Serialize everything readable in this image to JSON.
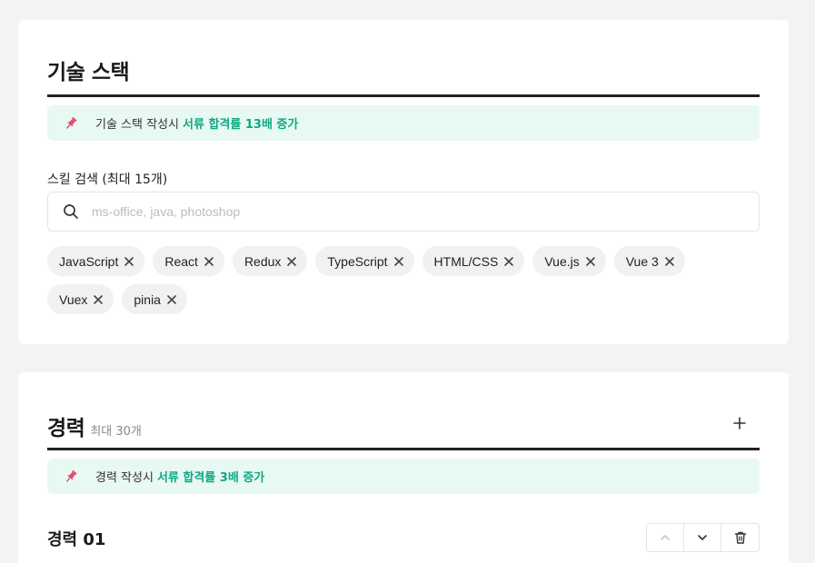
{
  "skills_section": {
    "title": "기술 스택",
    "tip_prefix": "기술 스택 작성시",
    "tip_highlight": "서류 합격률 13배 증가",
    "search_label": "스킬 검색 (최대 15개)",
    "search_placeholder": "ms-office, java, photoshop",
    "search_value": "",
    "chips": [
      "JavaScript",
      "React",
      "Redux",
      "TypeScript",
      "HTML/CSS",
      "Vue.js",
      "Vue 3",
      "Vuex",
      "pinia"
    ]
  },
  "career_section": {
    "title": "경력",
    "max_label": "최대 30개",
    "tip_prefix": "경력 작성시",
    "tip_highlight": "서류 합격률 3배 증가",
    "entry_title": "경력 01"
  },
  "icons": {
    "pin": "pin-icon",
    "search": "search-icon",
    "remove": "close-icon",
    "add": "plus-icon",
    "up": "chevron-up-icon",
    "down": "chevron-down-icon",
    "delete": "trash-icon"
  },
  "colors": {
    "accent": "#0fa983",
    "tip_bg": "#e8f8f3",
    "pin": "#e84a6f",
    "page_bg": "#f2f3f4"
  }
}
